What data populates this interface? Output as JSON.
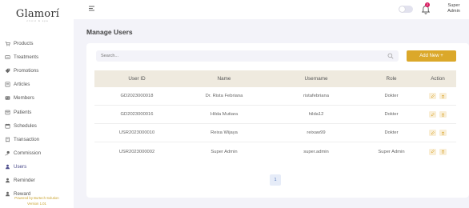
{
  "brand": {
    "name": "Glamorí",
    "tagline": "clinic & spa"
  },
  "sidebar": {
    "items": [
      {
        "label": "Products",
        "icon": "cart-icon"
      },
      {
        "label": "Treatments",
        "icon": "card-icon"
      },
      {
        "label": "Promotions",
        "icon": "tag-icon"
      },
      {
        "label": "Articles",
        "icon": "article-icon"
      },
      {
        "label": "Members",
        "icon": "member-card-icon"
      },
      {
        "label": "Patients",
        "icon": "patient-icon"
      },
      {
        "label": "Schedules",
        "icon": "calendar-icon"
      },
      {
        "label": "Transaction",
        "icon": "transaction-icon"
      },
      {
        "label": "Commission",
        "icon": "commission-icon"
      },
      {
        "label": "Users",
        "icon": "user-icon"
      },
      {
        "label": "Reminder",
        "icon": "user-icon"
      },
      {
        "label": "Reward",
        "icon": "user-icon"
      }
    ],
    "active": "Users",
    "footer_line1": "Powered by Burtech Solution",
    "footer_line2": "Version 1.01"
  },
  "header": {
    "notification_count": "2",
    "user_line1": "Super",
    "user_line2": "Admin"
  },
  "main": {
    "title": "Manage Users",
    "search_placeholder": "Search...",
    "add_button": "Add New +",
    "columns": [
      "User ID",
      "Name",
      "Username",
      "Role",
      "Action"
    ],
    "rows": [
      {
        "user_id": "GD2023000018",
        "name": "Dr. Rista Febriana",
        "username": "ristafebriana",
        "role": "Dokter"
      },
      {
        "user_id": "GD2023000016",
        "name": "Hilda Mutiara",
        "username": "hilda12",
        "role": "Dokter"
      },
      {
        "user_id": "USR2023000010",
        "name": "Reixa Wijaya",
        "username": "reixaw99",
        "role": "Dokter"
      },
      {
        "user_id": "USR2023000002",
        "name": "Super Admin",
        "username": "super.admin",
        "role": "Super Admin"
      }
    ],
    "pagination": [
      "1"
    ]
  },
  "colors": {
    "accent": "#dba82a",
    "active_nav": "#4a4a8a",
    "header_bg": "#efeadf",
    "background": "#f3f3f9"
  }
}
